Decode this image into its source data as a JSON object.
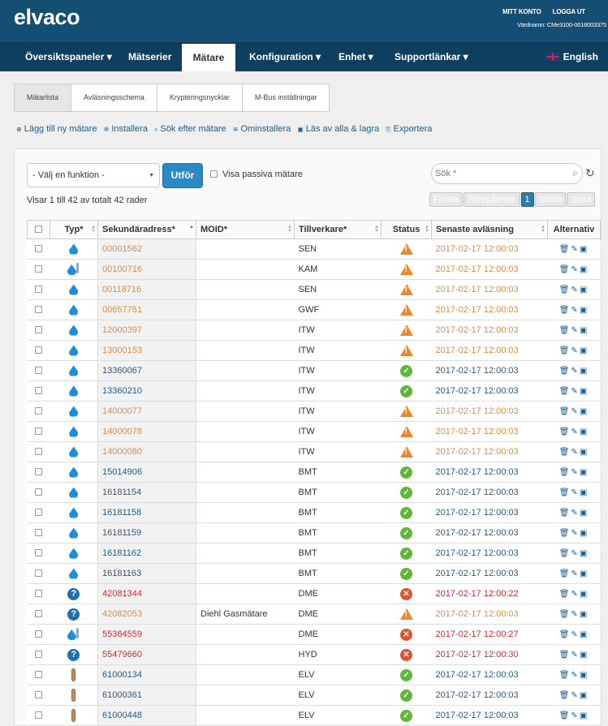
{
  "header": {
    "logo": "elvaco",
    "account": "MITT KONTO",
    "logout": "LOGGA UT",
    "hostname": "Värdnamn: CMe3100-0016003375"
  },
  "nav": {
    "items": [
      "Översiktspaneler ▾",
      "Mätserier",
      "Mätare",
      "Konfiguration ▾",
      "Enhet ▾",
      "Supportlänkar ▾"
    ],
    "active": "Mätare",
    "language": "English"
  },
  "subtabs": [
    "Mätarlista",
    "Avläsningsschema",
    "Krypteringsnycklar",
    "M-Bus inställningar"
  ],
  "actions": [
    "Lägg till ny mätare",
    "Installera",
    "Sök efter mätare",
    "Ominstallera",
    "Läs av alla & lagra",
    "Exportera"
  ],
  "toolbar": {
    "select_value": "- Välj en funktion -",
    "execute_label": "Utför",
    "show_passive": "Visa passiva mätare",
    "search_placeholder": "Sök *",
    "info": "Visar 1 till 42 av totalt 42 rader"
  },
  "pager": [
    "Första",
    "Föregående",
    "1",
    "Nästa",
    "Sista"
  ],
  "table": {
    "headers": [
      "Typ*",
      "Sekundäradress*",
      "MOID*",
      "Tillverkare*",
      "Status",
      "Senaste avläsning",
      "Alternativ"
    ],
    "rows": [
      {
        "icon": "water",
        "addr": "00001562",
        "moid": "",
        "mfr": "SEN",
        "status": "warn",
        "last": "2017-02-17 12:00:03"
      },
      {
        "icon": "water-temp",
        "addr": "00100716",
        "moid": "",
        "mfr": "KAM",
        "status": "warn",
        "last": "2017-02-17 12:00:03"
      },
      {
        "icon": "water",
        "addr": "00118716",
        "moid": "",
        "mfr": "SEN",
        "status": "warn",
        "last": "2017-02-17 12:00:03"
      },
      {
        "icon": "water",
        "addr": "00657751",
        "moid": "",
        "mfr": "GWF",
        "status": "warn",
        "last": "2017-02-17 12:00:03"
      },
      {
        "icon": "water",
        "addr": "12000397",
        "moid": "",
        "mfr": "ITW",
        "status": "warn",
        "last": "2017-02-17 12:00:03"
      },
      {
        "icon": "water",
        "addr": "13000153",
        "moid": "",
        "mfr": "ITW",
        "status": "warn",
        "last": "2017-02-17 12:00:03"
      },
      {
        "icon": "water",
        "addr": "13360067",
        "moid": "",
        "mfr": "ITW",
        "status": "ok",
        "last": "2017-02-17 12:00:03"
      },
      {
        "icon": "water",
        "addr": "13360210",
        "moid": "",
        "mfr": "ITW",
        "status": "ok",
        "last": "2017-02-17 12:00:03"
      },
      {
        "icon": "water",
        "addr": "14000077",
        "moid": "",
        "mfr": "ITW",
        "status": "warn",
        "last": "2017-02-17 12:00:03"
      },
      {
        "icon": "water",
        "addr": "14000078",
        "moid": "",
        "mfr": "ITW",
        "status": "warn",
        "last": "2017-02-17 12:00:03"
      },
      {
        "icon": "water",
        "addr": "14000080",
        "moid": "",
        "mfr": "ITW",
        "status": "warn",
        "last": "2017-02-17 12:00:03"
      },
      {
        "icon": "water",
        "addr": "15014906",
        "moid": "",
        "mfr": "BMT",
        "status": "ok",
        "last": "2017-02-17 12:00:03"
      },
      {
        "icon": "water",
        "addr": "16181154",
        "moid": "",
        "mfr": "BMT",
        "status": "ok",
        "last": "2017-02-17 12:00:03"
      },
      {
        "icon": "water",
        "addr": "16181158",
        "moid": "",
        "mfr": "BMT",
        "status": "ok",
        "last": "2017-02-17 12:00:03"
      },
      {
        "icon": "water",
        "addr": "16181159",
        "moid": "",
        "mfr": "BMT",
        "status": "ok",
        "last": "2017-02-17 12:00:03"
      },
      {
        "icon": "water",
        "addr": "16181162",
        "moid": "",
        "mfr": "BMT",
        "status": "ok",
        "last": "2017-02-17 12:00:03"
      },
      {
        "icon": "water",
        "addr": "16181163",
        "moid": "",
        "mfr": "BMT",
        "status": "ok",
        "last": "2017-02-17 12:00:03"
      },
      {
        "icon": "unknown",
        "addr": "42081344",
        "moid": "",
        "mfr": "DME",
        "status": "error",
        "last": "2017-02-17 12:00:22"
      },
      {
        "icon": "unknown",
        "addr": "42082053",
        "moid": "Diehl Gasmätare",
        "mfr": "DME",
        "status": "warn",
        "last": "2017-02-17 12:00:03"
      },
      {
        "icon": "water-temp",
        "addr": "55364559",
        "moid": "",
        "mfr": "DME",
        "status": "error",
        "last": "2017-02-17 12:00:27"
      },
      {
        "icon": "unknown",
        "addr": "55479660",
        "moid": "",
        "mfr": "HYD",
        "status": "error",
        "last": "2017-02-17 12:00:30"
      },
      {
        "icon": "temperature",
        "addr": "61000134",
        "moid": "",
        "mfr": "ELV",
        "status": "ok",
        "last": "2017-02-17 12:00:03"
      },
      {
        "icon": "temperature",
        "addr": "61000361",
        "moid": "",
        "mfr": "ELV",
        "status": "ok",
        "last": "2017-02-17 12:00:03"
      },
      {
        "icon": "temperature",
        "addr": "61000448",
        "moid": "",
        "mfr": "ELV",
        "status": "ok",
        "last": "2017-02-17 12:00:03"
      }
    ]
  },
  "colors": {
    "header": "#154e73",
    "nav": "#0f3f5f",
    "ok": "#5fb833",
    "warn": "#f0862a",
    "error": "#e2512f",
    "link": "#1c5d8f"
  }
}
